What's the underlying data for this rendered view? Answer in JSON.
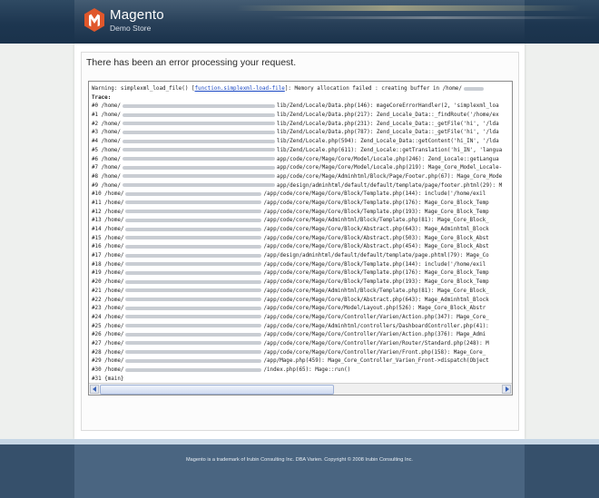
{
  "header": {
    "logo_name": "Magento",
    "logo_sub": "Demo Store",
    "colors": {
      "bar": "#1d3650",
      "logo_red": "#e0572b"
    }
  },
  "main": {
    "error_title": "There has been an error processing your request."
  },
  "trace": {
    "warning_prefix": "Warning: simplexml_load_file() [",
    "warning_link": "function.simplexml-load-file",
    "warning_suffix": "]: Memory allocation failed : creating buffer  in /home/",
    "trace_label": "Trace:",
    "lines": [
      {
        "n": "#0 /home/",
        "text": "lib/Zend/Locale/Data.php(146): mageCoreErrorHandler(2, 'simplexml_loa"
      },
      {
        "n": "#1 /home/",
        "text": "lib/Zend/Locale/Data.php(217): Zend_Locale_Data::_findRoute('/home/ex"
      },
      {
        "n": "#2 /home/",
        "text": "lib/Zend/Locale/Data.php(231): Zend_Locale_Data::_getFile('hi', '/lda"
      },
      {
        "n": "#3 /home/",
        "text": "lib/Zend/Locale/Data.php(787): Zend_Locale_Data::_getFile('hi', '/lda"
      },
      {
        "n": "#4 /home/",
        "text": "lib/Zend/Locale.php(594): Zend_Locale_Data::getContent('hi_IN', '/lda"
      },
      {
        "n": "#5 /home/",
        "text": "lib/Zend/Locale.php(611): Zend_Locale::getTranslation('hi_IN', 'langua"
      },
      {
        "n": "#6 /home/",
        "text": "app/code/core/Mage/Core/Model/Locale.php(246): Zend_Locale::getLangua"
      },
      {
        "n": "#7 /home/",
        "text": "app/code/core/Mage/Core/Model/Locale.php(219): Mage_Core_Model_Locale-"
      },
      {
        "n": "#8 /home/",
        "text": "app/code/core/Mage/Adminhtml/Block/Page/Footer.php(67): Mage_Core_Mode"
      },
      {
        "n": "#9 /home/",
        "text": "app/design/adminhtml/default/default/template/page/footer.phtml(29): M"
      },
      {
        "n": "#10 /home/",
        "text": "/app/code/core/Mage/Core/Block/Template.php(144): include('/home/exil"
      },
      {
        "n": "#11 /home/",
        "text": "/app/code/core/Mage/Core/Block/Template.php(176): Mage_Core_Block_Temp"
      },
      {
        "n": "#12 /home/",
        "text": "/app/code/core/Mage/Core/Block/Template.php(193): Mage_Core_Block_Temp"
      },
      {
        "n": "#13 /home/",
        "text": "/app/code/core/Mage/Adminhtml/Block/Template.php(81): Mage_Core_Block_"
      },
      {
        "n": "#14 /home/",
        "text": "/app/code/core/Mage/Core/Block/Abstract.php(643): Mage_Adminhtml_Block"
      },
      {
        "n": "#15 /home/",
        "text": "/app/code/core/Mage/Core/Block/Abstract.php(503): Mage_Core_Block_Abst"
      },
      {
        "n": "#16 /home/",
        "text": "/app/code/core/Mage/Core/Block/Abstract.php(454): Mage_Core_Block_Abst"
      },
      {
        "n": "#17 /home/",
        "text": "/app/design/adminhtml/default/default/template/page.phtml(79): Mage_Co"
      },
      {
        "n": "#18 /home/",
        "text": "/app/code/core/Mage/Core/Block/Template.php(144): include('/home/exil"
      },
      {
        "n": "#19 /home/",
        "text": "/app/code/core/Mage/Core/Block/Template.php(176): Mage_Core_Block_Temp"
      },
      {
        "n": "#20 /home/",
        "text": "/app/code/core/Mage/Core/Block/Template.php(193): Mage_Core_Block_Temp"
      },
      {
        "n": "#21 /home/",
        "text": "/app/code/core/Mage/Adminhtml/Block/Template.php(81): Mage_Core_Block_"
      },
      {
        "n": "#22 /home/",
        "text": "/app/code/core/Mage/Core/Block/Abstract.php(643): Mage_Adminhtml_Block"
      },
      {
        "n": "#23 /home/",
        "text": "/app/code/core/Mage/Core/Model/Layout.php(526): Mage_Core_Block_Abstr"
      },
      {
        "n": "#24 /home/",
        "text": "/app/code/core/Mage/Core/Controller/Varien/Action.php(347): Mage_Core_"
      },
      {
        "n": "#25 /home/",
        "text": "/app/code/core/Mage/Adminhtml/controllers/DashboardController.php(41):"
      },
      {
        "n": "#26 /home/",
        "text": "/app/code/core/Mage/Core/Controller/Varien/Action.php(376): Mage_Admi"
      },
      {
        "n": "#27 /home/",
        "text": "/app/code/core/Mage/Core/Controller/Varien/Router/Standard.php(248): M"
      },
      {
        "n": "#28 /home/",
        "text": "/app/code/core/Mage/Core/Controller/Varien/Front.php(158): Mage_Core_"
      },
      {
        "n": "#29 /home/",
        "text": "/app/Mage.php(459): Mage_Core_Controller_Varien_Front->dispatch(Object"
      },
      {
        "n": "#30 /home/",
        "text": "/index.php(65): Mage::run()"
      }
    ],
    "last_line": "#31 {main}"
  },
  "footer": {
    "text": "Magento is a trademark of Irubin Consulting Inc. DBA Varien. Copyright © 2008 Irubin Consulting Inc."
  }
}
